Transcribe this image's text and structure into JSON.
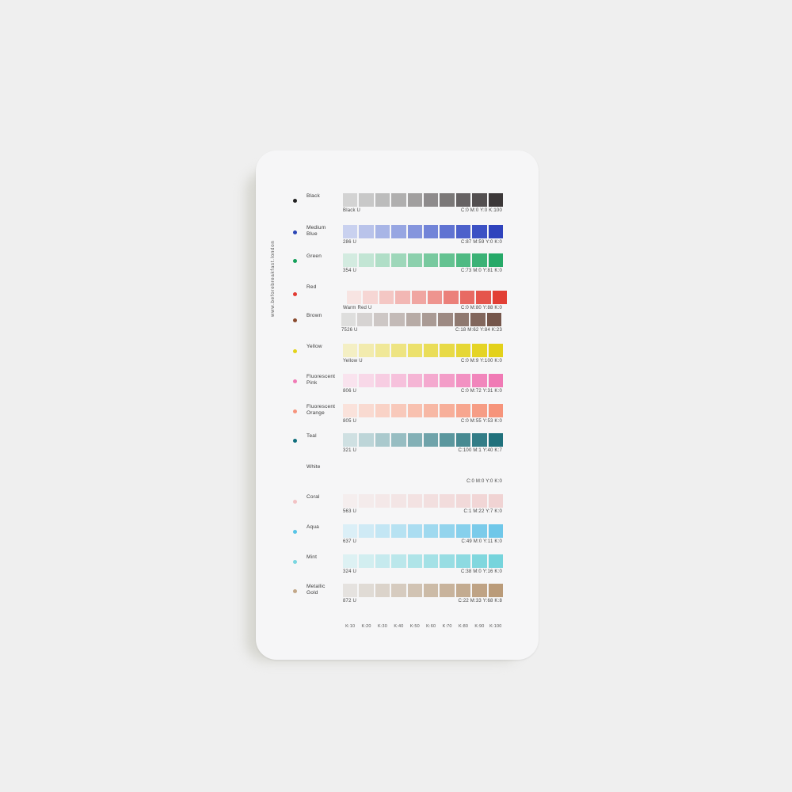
{
  "card": {
    "website": "www.beforebreakfast.london",
    "k_labels": [
      "K:10",
      "K:20",
      "K:30",
      "K:40",
      "K:50",
      "K:60",
      "K:70",
      "K:80",
      "K:90",
      "K:100"
    ],
    "rows": [
      {
        "name": "Black",
        "code": "Black U",
        "cmyk": "C:0 M:0 Y:0 K:100",
        "dot_color": "#222222",
        "swatches": [
          "#d3d3d3",
          "#c8c8c8",
          "#bcbcbc",
          "#b0afaf",
          "#a19f9f",
          "#8e8b8c",
          "#7b7878",
          "#666263",
          "#534f50",
          "#3c3839"
        ]
      },
      {
        "name": "Medium\nBlue",
        "code": "286 U",
        "cmyk": "C:87 M:59 Y:0 K:0",
        "dot_color": "#2a45b5",
        "swatches": [
          "#c9d1ef",
          "#b9c3ea",
          "#a8b5e6",
          "#97a6e2",
          "#8595dd",
          "#7284d8",
          "#6073d2",
          "#4d61cb",
          "#3c51c4",
          "#2f43bd"
        ]
      },
      {
        "name": "Green",
        "code": "354 U",
        "cmyk": "C:73 M:0 Y:81 K:0",
        "dot_color": "#14a05a",
        "swatches": [
          "#d3ebe0",
          "#c2e5d4",
          "#b0dec7",
          "#9ed7ba",
          "#8cd0ad",
          "#78c99f",
          "#64c291",
          "#4fba83",
          "#3bb276",
          "#26a968"
        ]
      },
      {
        "name": "Red",
        "code": "Warm Red U",
        "cmyk": "C:0 M:80 Y:88 K:0",
        "dot_color": "#e23a32",
        "swatches": [
          "#f7e4e2",
          "#f6d6d4",
          "#f4c7c4",
          "#f2b7b4",
          "#f0a6a2",
          "#ee948f",
          "#eb807a",
          "#e86a63",
          "#e5554c",
          "#e23f35"
        ]
      },
      {
        "name": "Brown",
        "code": "7526 U",
        "cmyk": "C:18 M:62 Y:84 K:23",
        "dot_color": "#8a4a2e",
        "swatches": [
          "#dededd",
          "#d6d3d2",
          "#cdc7c5",
          "#c3bab7",
          "#b7aba6",
          "#aa9b95",
          "#9d8a83",
          "#8f7970",
          "#82675d",
          "#75564b"
        ]
      },
      {
        "name": "Yellow",
        "code": "Yellow U",
        "cmyk": "C:0 M:9 Y:100 K:0",
        "dot_color": "#e3d21a",
        "swatches": [
          "#f4efc4",
          "#f2ebae",
          "#f0e898",
          "#eee482",
          "#ece16c",
          "#eadd58",
          "#e8da46",
          "#e6d735",
          "#e5d425",
          "#e3d11a"
        ]
      },
      {
        "name": "Fluorescent\nPink",
        "code": "806 U",
        "cmyk": "C:0 M:72 Y:31 K:0",
        "dot_color": "#f07ab5",
        "swatches": [
          "#f9e3ee",
          "#f8d8e8",
          "#f7cde2",
          "#f6c1dc",
          "#f5b5d5",
          "#f4a9cf",
          "#f39dc8",
          "#f291c2",
          "#f186bc",
          "#f07ab5"
        ]
      },
      {
        "name": "Fluorescent\nOrange",
        "code": "805 U",
        "cmyk": "C:0 M:55 Y:53 K:0",
        "dot_color": "#f6937c",
        "swatches": [
          "#fae2db",
          "#f9dad1",
          "#f9d2c6",
          "#f8c9bb",
          "#f8c1b0",
          "#f7b8a5",
          "#f7af9a",
          "#f7a68f",
          "#f69d85",
          "#f6947b"
        ]
      },
      {
        "name": "Teal",
        "code": "321 U",
        "cmyk": "C:100 M:1 Y:40 K:7",
        "dot_color": "#0f6e7c",
        "swatches": [
          "#cfe0e2",
          "#bdd5d8",
          "#aac9cd",
          "#97bdc2",
          "#83b0b6",
          "#6fa3aa",
          "#5b979e",
          "#478a92",
          "#337d87",
          "#20717c"
        ]
      },
      {
        "name": "White",
        "code": "",
        "cmyk": "C:0 M:0 Y:0 K:0",
        "dot_color": "#f6f6f7",
        "swatches": [
          "#f6f6f7",
          "#f6f6f7",
          "#f6f6f7",
          "#f6f6f7",
          "#f6f6f7",
          "#f6f6f7",
          "#f6f6f7",
          "#f6f6f7",
          "#f6f6f7",
          "#f6f6f7"
        ]
      },
      {
        "name": "Coral",
        "code": "563 U",
        "cmyk": "C:1 M:22 Y:7 K:0",
        "dot_color": "#f2c2c4",
        "swatches": [
          "#f5eeee",
          "#f4ebeb",
          "#f4e8e8",
          "#f3e5e5",
          "#f3e2e2",
          "#f2dfdf",
          "#f2dcdc",
          "#f1d9d9",
          "#f1d6d6",
          "#f0d3d3"
        ]
      },
      {
        "name": "Aqua",
        "code": "637 U",
        "cmyk": "C:49 M:0 Y:11 K:0",
        "dot_color": "#57c4e6",
        "swatches": [
          "#dbeff7",
          "#cfeaf5",
          "#c3e6f4",
          "#b7e2f2",
          "#abddf1",
          "#9fd9ef",
          "#93d4ed",
          "#87d0ec",
          "#7bcbea",
          "#6fc7e9"
        ]
      },
      {
        "name": "Mint",
        "code": "324 U",
        "cmyk": "C:38 M:0 Y:16 K:0",
        "dot_color": "#7ad6e0",
        "swatches": [
          "#ddf1f3",
          "#d2eef0",
          "#c6eaee",
          "#bbe7eb",
          "#afe4e8",
          "#a4e1e6",
          "#98dde3",
          "#8ddae1",
          "#81d7de",
          "#76d4dc"
        ]
      },
      {
        "name": "Metallic\nGold",
        "code": "872 U",
        "cmyk": "C:22 M:33 Y:68 K:8",
        "dot_color": "#c2a788",
        "swatches": [
          "#e5e2df",
          "#e0dbd5",
          "#dbd3ca",
          "#d6cbbf",
          "#d1c3b3",
          "#ccbba7",
          "#c8b39c",
          "#c3ab90",
          "#bfa385",
          "#ba9b79"
        ]
      }
    ]
  }
}
